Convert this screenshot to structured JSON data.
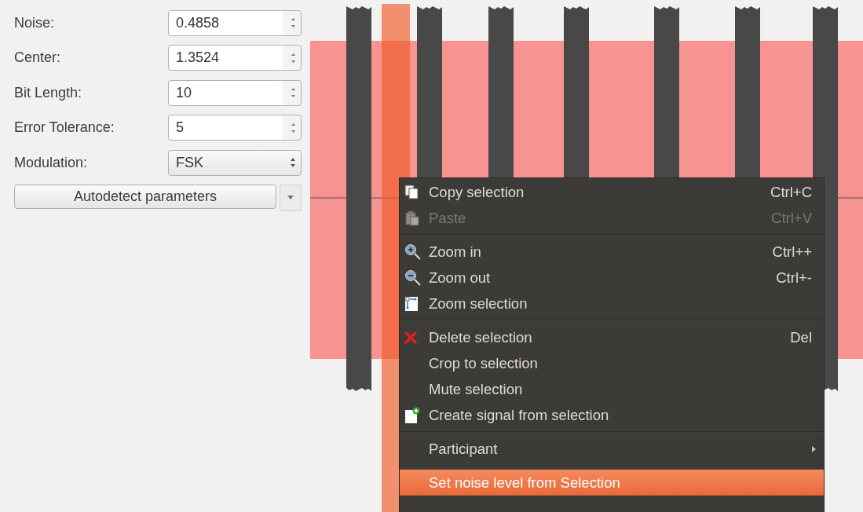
{
  "parameters": [
    {
      "label": "Noise:",
      "value": "0.4858",
      "kind": "spinbox"
    },
    {
      "label": "Center:",
      "value": "1.3524",
      "kind": "spinbox"
    },
    {
      "label": "Bit Length:",
      "value": "10",
      "kind": "spinbox"
    },
    {
      "label": "Error Tolerance:",
      "value": "5",
      "kind": "spinbox"
    },
    {
      "label": "Modulation:",
      "value": "FSK",
      "kind": "combo"
    }
  ],
  "autodetect_button": {
    "label": "Autodetect parameters"
  },
  "context_menu": {
    "sections": [
      [
        {
          "label": "Copy selection",
          "shortcut": "Ctrl+C",
          "disabled": false,
          "selected": false
        },
        {
          "label": "Paste",
          "shortcut": "Ctrl+V",
          "disabled": true,
          "selected": false
        }
      ],
      [
        {
          "label": "Zoom in",
          "shortcut": "Ctrl++",
          "disabled": false,
          "selected": false
        },
        {
          "label": "Zoom out",
          "shortcut": "Ctrl+-",
          "disabled": false,
          "selected": false
        },
        {
          "label": "Zoom selection",
          "disabled": false,
          "selected": false
        }
      ],
      [
        {
          "label": "Delete selection",
          "shortcut": "Del",
          "disabled": false,
          "selected": false
        },
        {
          "label": "Crop to selection",
          "disabled": false,
          "selected": false
        },
        {
          "label": "Mute selection",
          "disabled": false,
          "selected": false
        },
        {
          "label": "Create signal from selection",
          "disabled": false,
          "selected": false
        }
      ],
      [
        {
          "label": "Participant",
          "submenu": true,
          "disabled": false,
          "selected": false
        }
      ],
      [
        {
          "label": "Set noise level from Selection",
          "disabled": false,
          "selected": true
        }
      ]
    ]
  }
}
